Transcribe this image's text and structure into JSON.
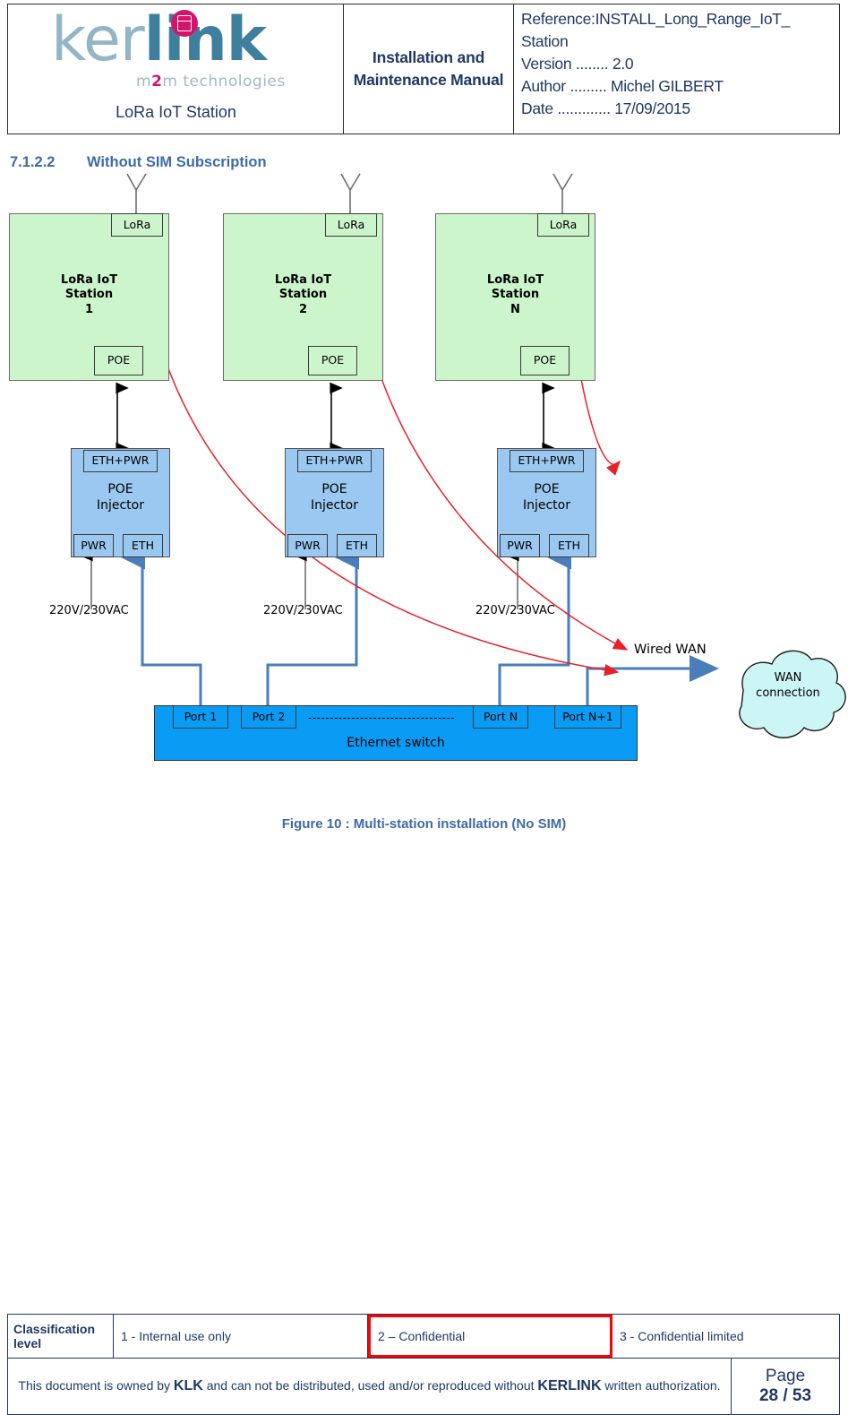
{
  "header": {
    "logo": {
      "word_light": "ker",
      "word_bold": "link",
      "tagline_pre": "m",
      "tagline_mid": "2",
      "tagline_post": "m technologies",
      "product": "LoRa IoT Station"
    },
    "doc_title": "Installation and\nMaintenance\nManual",
    "meta": {
      "reference": "Reference:INSTALL_Long_Range_IoT_",
      "reference_cont": "Station",
      "version": "Version ........ 2.0",
      "author": "Author ......... Michel GILBERT",
      "date": "Date ............. 17/09/2015"
    }
  },
  "section": {
    "number": "7.1.2.2",
    "title": "Without SIM Subscription"
  },
  "figure": {
    "caption": "Figure 10 : Multi-station installation (No SIM)"
  },
  "diagram": {
    "stations": [
      {
        "port_label": "LoRa",
        "name": "LoRa IoT\nStation\n1",
        "poe_label": "POE"
      },
      {
        "port_label": "LoRa",
        "name": "LoRa IoT\nStation\n2",
        "poe_label": "POE"
      },
      {
        "port_label": "LoRa",
        "name": "LoRa IoT\nStation\nN",
        "poe_label": "POE"
      }
    ],
    "injectors": [
      {
        "top_port": "ETH+PWR",
        "name": "POE\nInjector",
        "left_port": "PWR",
        "right_port": "ETH",
        "voltage": "220V/230VAC"
      },
      {
        "top_port": "ETH+PWR",
        "name": "POE\nInjector",
        "left_port": "PWR",
        "right_port": "ETH",
        "voltage": "220V/230VAC"
      },
      {
        "top_port": "ETH+PWR",
        "name": "POE\nInjector",
        "left_port": "PWR",
        "right_port": "ETH",
        "voltage": "220V/230VAC"
      }
    ],
    "switch": {
      "label": "Ethernet switch",
      "ports": [
        "Port 1",
        "Port 2",
        "Port N",
        "Port N+1"
      ],
      "ellipsis": "----------------------------------"
    },
    "wan": {
      "link_label": "Wired WAN",
      "cloud_label": "WAN\nconnection"
    },
    "colors": {
      "station_fill": "#ccf5cc",
      "injector_fill": "#9ac8f0",
      "switch_fill": "#0a9cf5",
      "cloud_fill": "#ccf5f5",
      "lora_link": "#ff0000",
      "eth_link": "#4a7ebb",
      "power_link": "#000000"
    }
  },
  "footer": {
    "classification_label": "Classification\nlevel",
    "levels": [
      "1 - Internal use only",
      "2 – Confidential",
      "3 - Confidential limited"
    ],
    "selected_level_index": 1,
    "highlight_color": "#ff0000",
    "legal_part1": "This document is owned by ",
    "legal_klk": "KLK",
    "legal_part2": " and can not be distributed, used and/or reproduced  without ",
    "legal_kerlink": "KERLINK",
    "legal_part3": " written authorization.",
    "page_word": "Page",
    "page_number": "28 / 53"
  }
}
